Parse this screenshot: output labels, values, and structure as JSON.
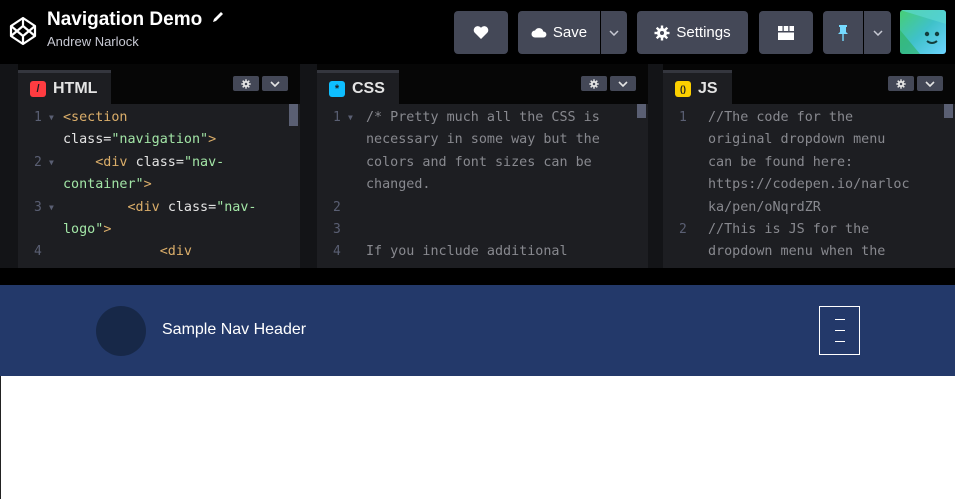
{
  "header": {
    "pen_title": "Navigation Demo",
    "author": "Andrew Narlock",
    "buttons": {
      "save_label": "Save",
      "settings_label": "Settings"
    },
    "icons": {
      "logo": "codepen-logo-icon",
      "edit": "pencil-icon",
      "like": "heart-icon",
      "save": "cloud-icon",
      "settings": "gear-icon",
      "layout": "layout-grid-icon",
      "pin": "pin-icon"
    }
  },
  "editors": [
    {
      "name": "html",
      "label": "HTML",
      "icon_char": "/",
      "icon_color": "#ff3c41",
      "gutter": [
        {
          "n": "1",
          "fold": true
        },
        {
          "n": "2",
          "fold": true
        },
        {
          "n": "3",
          "fold": true
        },
        {
          "n": "4",
          "fold": false
        }
      ],
      "lines": [
        [
          {
            "t": "<section",
            "c": "t-tag"
          }
        ],
        [
          {
            "t": "class=",
            "c": "t-attr"
          },
          {
            "t": "\"navigation\"",
            "c": "t-str"
          },
          {
            "t": ">",
            "c": "t-tag"
          }
        ],
        [
          {
            "t": "    <div ",
            "c": "t-tag"
          },
          {
            "t": "class=",
            "c": "t-attr"
          },
          {
            "t": "\"nav-",
            "c": "t-str"
          }
        ],
        [
          {
            "t": "container\"",
            "c": "t-str"
          },
          {
            "t": ">",
            "c": "t-tag"
          }
        ],
        [
          {
            "t": "        <div ",
            "c": "t-tag"
          },
          {
            "t": "class=",
            "c": "t-attr"
          },
          {
            "t": "\"nav-",
            "c": "t-str"
          }
        ],
        [
          {
            "t": "logo\"",
            "c": "t-str"
          },
          {
            "t": ">",
            "c": "t-tag"
          }
        ],
        [
          {
            "t": "            <div",
            "c": "t-tag"
          }
        ]
      ]
    },
    {
      "name": "css",
      "label": "CSS",
      "icon_char": "*",
      "icon_color": "#0ebeff",
      "gutter": [
        {
          "n": "1",
          "fold": true
        },
        {
          "n": "",
          "fold": false
        },
        {
          "n": "",
          "fold": false
        },
        {
          "n": "",
          "fold": false
        },
        {
          "n": "2",
          "fold": false
        },
        {
          "n": "3",
          "fold": false
        },
        {
          "n": "4",
          "fold": false
        }
      ],
      "lines": [
        [
          {
            "t": "/* Pretty much all the CSS is",
            "c": "t-com"
          }
        ],
        [
          {
            "t": "necessary in some way but the",
            "c": "t-com"
          }
        ],
        [
          {
            "t": "colors and font sizes can be",
            "c": "t-com"
          }
        ],
        [
          {
            "t": "changed.",
            "c": "t-com"
          }
        ],
        [
          {
            "t": "",
            "c": "t-com"
          }
        ],
        [
          {
            "t": "",
            "c": "t-com"
          }
        ],
        [
          {
            "t": "If you include additional",
            "c": "t-com"
          }
        ]
      ]
    },
    {
      "name": "js",
      "label": "JS",
      "icon_char": "()",
      "icon_color": "#fcd000",
      "gutter": [
        {
          "n": "1",
          "fold": false
        },
        {
          "n": "",
          "fold": false
        },
        {
          "n": "",
          "fold": false
        },
        {
          "n": "",
          "fold": false
        },
        {
          "n": "",
          "fold": false
        },
        {
          "n": "2",
          "fold": false
        },
        {
          "n": "",
          "fold": false
        }
      ],
      "lines": [
        [
          {
            "t": "//The code for the",
            "c": "t-com"
          }
        ],
        [
          {
            "t": "original dropdown menu",
            "c": "t-com"
          }
        ],
        [
          {
            "t": "can be found here:",
            "c": "t-com"
          }
        ],
        [
          {
            "t": "https://codepen.io/narloc",
            "c": "t-com"
          }
        ],
        [
          {
            "t": "ka/pen/oNqrdZR",
            "c": "t-com"
          }
        ],
        [
          {
            "t": "//This is JS for the",
            "c": "t-com"
          }
        ],
        [
          {
            "t": "dropdown menu when the",
            "c": "t-com"
          }
        ]
      ]
    }
  ],
  "preview": {
    "nav_header": "Sample Nav Header",
    "colors": {
      "navbar": "#23396a",
      "logo_circle": "#172848"
    }
  }
}
